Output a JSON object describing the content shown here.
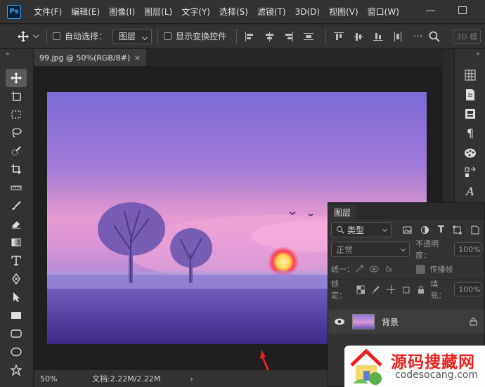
{
  "app": {
    "logo": "Ps"
  },
  "menu": [
    "文件(F)",
    "编辑(E)",
    "图像(I)",
    "图层(L)",
    "文字(Y)",
    "选择(S)",
    "滤镜(T)",
    "3D(D)",
    "视图(V)",
    "窗口(W)"
  ],
  "options": {
    "auto_select_label": "自动选择：",
    "auto_select_value": "图层",
    "show_transform_label": "显示变换控件",
    "btn_3d": "3D 模"
  },
  "document": {
    "tab_title": "99.jpg @ 50%(RGB/8#)",
    "close": "×"
  },
  "status": {
    "zoom": "50%",
    "doc_info": "文档:2.22M/2.22M",
    "arrow": "›"
  },
  "layers_panel": {
    "title": "图层",
    "filter_label": "类型",
    "blend_mode": "正常",
    "opacity_label": "不透明度：",
    "opacity_value": "100%",
    "unify_label": "统一：",
    "propagate_label": "传播帧",
    "lock_label": "锁定：",
    "fill_label": "填充：",
    "fill_value": "100%",
    "layer_name": "背景"
  },
  "watermark": {
    "title": "源码搜藏网",
    "url": "codesocang.com"
  },
  "colors": {
    "accent": "#31a8ff",
    "arrow": "#e8231f",
    "watermark_text": "#e8231f"
  }
}
